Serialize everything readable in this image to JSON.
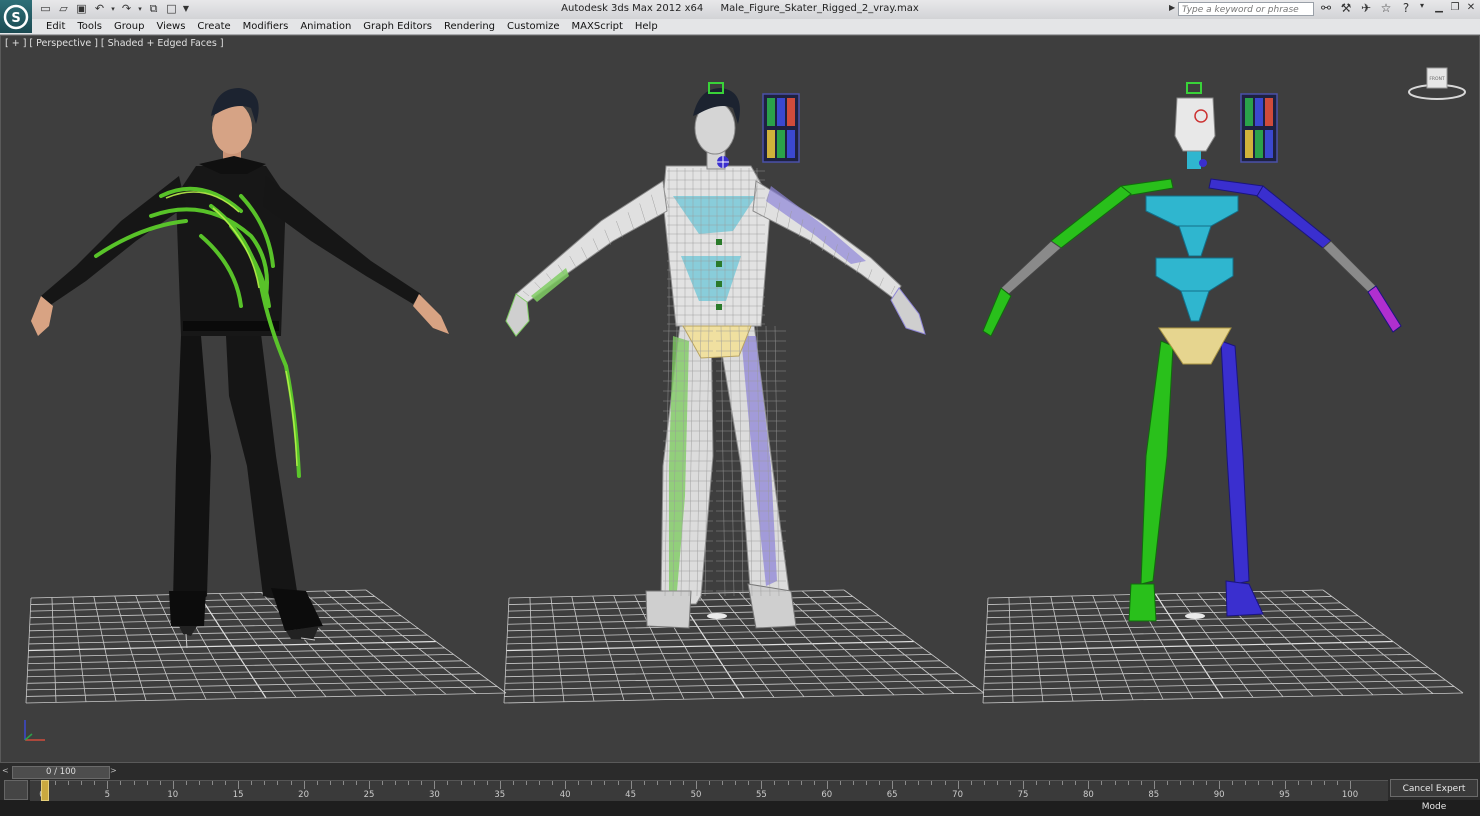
{
  "titlebar": {
    "app_name": "Autodesk 3ds Max  2012 x64",
    "file_name": "Male_Figure_Skater_Rigged_2_vray.max",
    "search_placeholder": "Type a keyword or phrase"
  },
  "logo_text": "S",
  "menu": [
    "Edit",
    "Tools",
    "Group",
    "Views",
    "Create",
    "Modifiers",
    "Animation",
    "Graph Editors",
    "Rendering",
    "Customize",
    "MAXScript",
    "Help"
  ],
  "viewport": {
    "label": "[ + ] [ Perspective ] [ Shaded + Edged Faces ]",
    "viewcube_label": "FRONT"
  },
  "timeline": {
    "frame_display": "0 / 100",
    "prev_symbol": "<",
    "next_symbol": ">",
    "ticks": [
      "0",
      "5",
      "10",
      "15",
      "20",
      "25",
      "30",
      "35",
      "40",
      "45",
      "50",
      "55",
      "60",
      "65",
      "70",
      "75",
      "80",
      "85",
      "90",
      "95",
      "100"
    ]
  },
  "cancel_expert_label": "Cancel Expert Mode",
  "colors": {
    "viewport_bg": "#3e3e3e",
    "grid_line": "#c9c9c9",
    "bone_green": "#29c01b",
    "bone_blue": "#3a2fcf",
    "bone_cyan": "#2fb6cf",
    "pelvis_yellow": "#e6d58f",
    "suit_black": "#141414",
    "suit_accent": "#6bd02b"
  },
  "icons": [
    "new-icon",
    "open-icon",
    "save-icon",
    "undo-icon",
    "redo-icon",
    "project-icon",
    "window-icon",
    "dropdown-icon",
    "binoculars-icon",
    "tools-icon",
    "communication-icon",
    "star-icon",
    "help-icon",
    "minimize-icon",
    "restore-icon",
    "close-icon"
  ]
}
